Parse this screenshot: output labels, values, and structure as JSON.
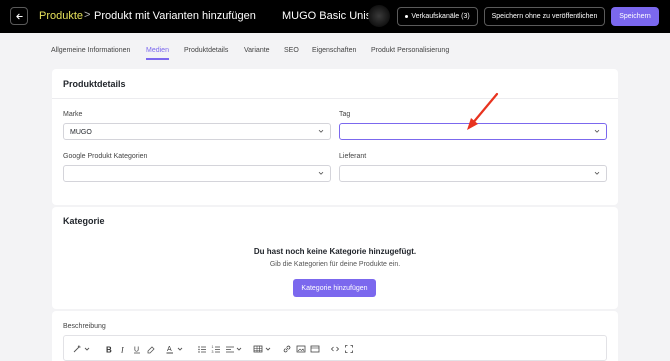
{
  "header": {
    "back_icon": "arrow-left-icon",
    "breadcrumb_root": "Produkte",
    "breadcrumb_separator": ">",
    "breadcrumb_current": "Produkt mit Varianten hinzufügen",
    "product_name": "MUGO Basic Unise:",
    "sales_channels_label": "Verkaufskanäle (3)",
    "save_without_publish_label": "Speichern ohne zu veröffentlichen",
    "save_label": "Speichern"
  },
  "tabs": [
    {
      "label": "Allgemeine Informationen",
      "active": false
    },
    {
      "label": "Medien",
      "active": true
    },
    {
      "label": "Produktdetails",
      "active": false
    },
    {
      "label": "Variante",
      "active": false
    },
    {
      "label": "SEO",
      "active": false
    },
    {
      "label": "Eigenschaften",
      "active": false
    },
    {
      "label": "Produkt Personalisierung",
      "active": false
    }
  ],
  "product_details": {
    "title": "Produktdetails",
    "brand_label": "Marke",
    "brand_value": "MUGO",
    "tag_label": "Tag",
    "tag_value": "",
    "google_category_label": "Google Produkt Kategorien",
    "google_category_value": "",
    "supplier_label": "Lieferant",
    "supplier_value": ""
  },
  "category": {
    "title": "Kategorie",
    "empty_title": "Du hast noch keine Kategorie hinzugefügt.",
    "empty_subtitle": "Gib die Kategorien für deine Produkte ein.",
    "add_button_label": "Kategorie hinzufügen"
  },
  "description": {
    "label": "Beschreibung",
    "toolbar_icons": [
      "magic-wand-icon",
      "bold-icon",
      "italic-icon",
      "underline-icon",
      "eraser-icon",
      "text-color-icon",
      "bullet-list-icon",
      "numbered-list-icon",
      "align-icon",
      "table-icon",
      "link-icon",
      "image-icon",
      "media-icon",
      "code-icon",
      "fullscreen-icon"
    ]
  },
  "colors": {
    "accent": "#7b68ee",
    "annotation_arrow": "#e8331f",
    "breadcrumb_root": "#e6e15a"
  }
}
